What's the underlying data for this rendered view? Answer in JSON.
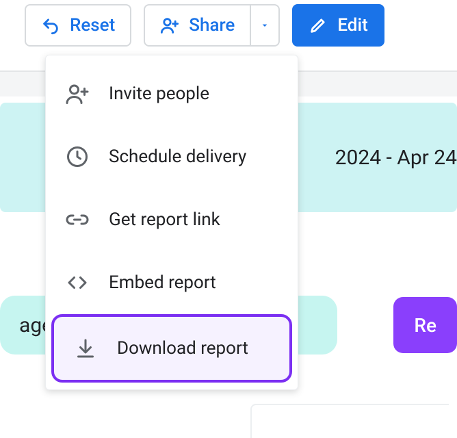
{
  "toolbar": {
    "reset_label": "Reset",
    "share_label": "Share",
    "edit_label": "Edit"
  },
  "date_range": "2024 - Apr 24",
  "age_chip": "age",
  "cta_label": "Re",
  "share_menu": {
    "items": [
      {
        "label": "Invite people",
        "icon": "person-add-icon"
      },
      {
        "label": "Schedule delivery",
        "icon": "clock-icon"
      },
      {
        "label": "Get report link",
        "icon": "link-icon"
      },
      {
        "label": "Embed report",
        "icon": "code-icon"
      },
      {
        "label": "Download report",
        "icon": "download-icon"
      }
    ]
  }
}
